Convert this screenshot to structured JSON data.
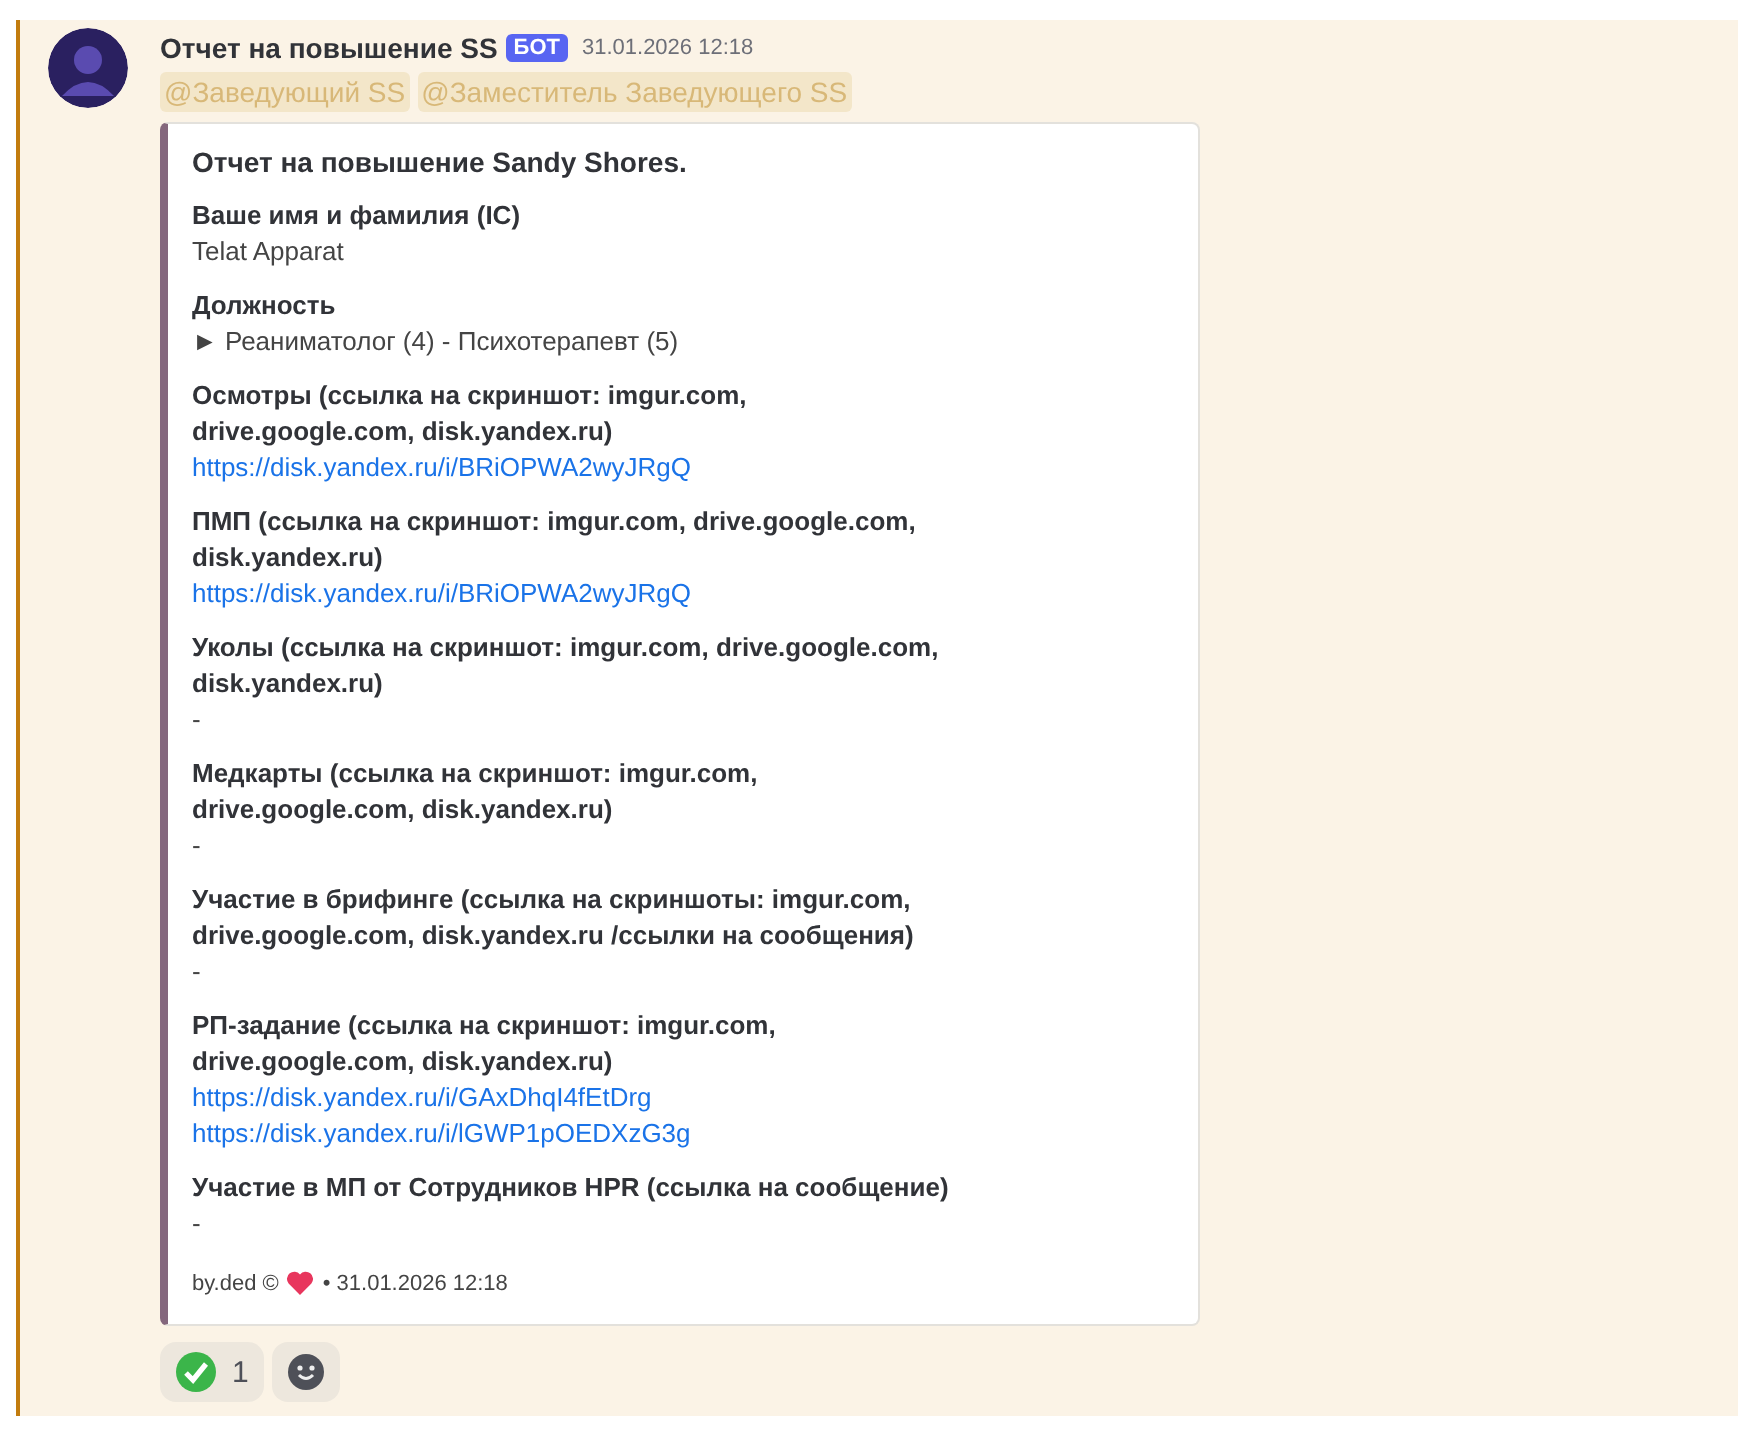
{
  "message": {
    "author": "Отчет на повышение SS",
    "badge": "БОТ",
    "timestamp": "31.01.2026 12:18",
    "mentions": [
      "@Заведующий SS",
      "@Заместитель Заведующего SS"
    ],
    "embed": {
      "title": "Отчет на повышение Sandy Shores.",
      "fields": [
        {
          "name": "Ваше имя и фамилия (IC)",
          "values": [
            {
              "kind": "text",
              "text": "Telat Apparat"
            }
          ]
        },
        {
          "name": "Должность",
          "values": [
            {
              "kind": "text",
              "text": "► Реаниматолог (4) - Психотерапевт (5)"
            }
          ]
        },
        {
          "name": "Осмотры (ссылка на скриншот: imgur.com, drive.google.com, disk.yandex.ru)",
          "values": [
            {
              "kind": "link",
              "text": "https://disk.yandex.ru/i/BRiOPWA2wyJRgQ"
            }
          ]
        },
        {
          "name": "ПМП (ссылка на скриншот: imgur.com, drive.google.com, disk.yandex.ru)",
          "values": [
            {
              "kind": "link",
              "text": "https://disk.yandex.ru/i/BRiOPWA2wyJRgQ"
            }
          ]
        },
        {
          "name": "Уколы (ссылка на скриншот: imgur.com, drive.google.com, disk.yandex.ru)",
          "values": [
            {
              "kind": "text",
              "text": "-"
            }
          ]
        },
        {
          "name": "Медкарты (ссылка на скриншот: imgur.com, drive.google.com, disk.yandex.ru)",
          "values": [
            {
              "kind": "text",
              "text": "-"
            }
          ]
        },
        {
          "name": "Участие в брифинге (ссылка на скриншоты: imgur.com, drive.google.com, disk.yandex.ru /ссылки на сообщения)",
          "values": [
            {
              "kind": "text",
              "text": "-"
            }
          ]
        },
        {
          "name": "РП-задание   (ссылка на скриншот: imgur.com, drive.google.com, disk.yandex.ru)",
          "values": [
            {
              "kind": "link",
              "text": "https://disk.yandex.ru/i/GAxDhqI4fEtDrg"
            },
            {
              "kind": "link",
              "text": "https://disk.yandex.ru/i/lGWP1pOEDXzG3g"
            }
          ]
        },
        {
          "name": "Участие в МП от Сотрудников HPR (ссылка на сообщение)",
          "values": [
            {
              "kind": "text",
              "text": "-"
            }
          ]
        }
      ],
      "footer": {
        "text": "by.ded ©",
        "timestamp": "• 31.01.2026 12:18"
      }
    },
    "reactions": [
      {
        "kind": "check",
        "count": "1",
        "selected": false
      },
      {
        "kind": "add"
      }
    ]
  }
}
